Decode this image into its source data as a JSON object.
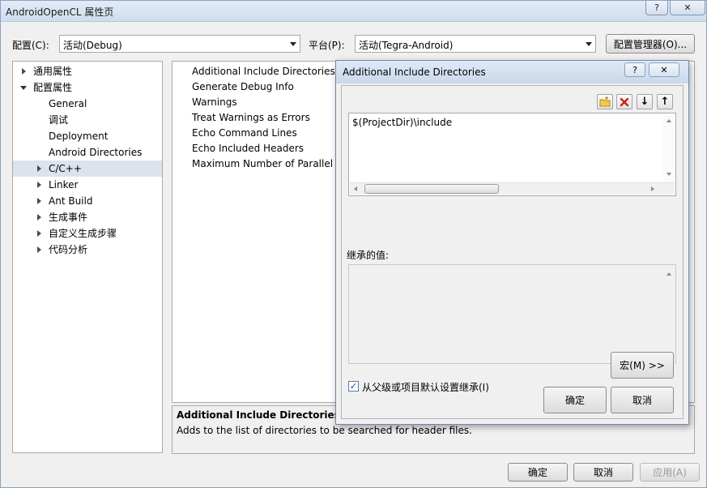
{
  "window": {
    "title": "AndroidOpenCL 属性页",
    "help_glyph": "?",
    "close_glyph": "✕"
  },
  "config": {
    "label": "配置(C):",
    "value": "活动(Debug)",
    "platform_label": "平台(P):",
    "platform_value": "活动(Tegra-Android)",
    "manager_button": "配置管理器(O)..."
  },
  "tree": {
    "items": [
      {
        "label": "通用属性",
        "expander": "collapsed",
        "indent": 0
      },
      {
        "label": "配置属性",
        "expander": "expanded",
        "indent": 0
      },
      {
        "label": "General",
        "expander": "none",
        "indent": 1
      },
      {
        "label": "调试",
        "expander": "none",
        "indent": 1
      },
      {
        "label": "Deployment",
        "expander": "none",
        "indent": 1
      },
      {
        "label": "Android Directories",
        "expander": "none",
        "indent": 1
      },
      {
        "label": "C/C++",
        "expander": "collapsed",
        "indent": 1,
        "selected": true
      },
      {
        "label": "Linker",
        "expander": "collapsed",
        "indent": 1
      },
      {
        "label": "Ant Build",
        "expander": "collapsed",
        "indent": 1
      },
      {
        "label": "生成事件",
        "expander": "collapsed",
        "indent": 1
      },
      {
        "label": "自定义生成步骤",
        "expander": "collapsed",
        "indent": 1
      },
      {
        "label": "代码分析",
        "expander": "collapsed",
        "indent": 1
      }
    ]
  },
  "grid": {
    "rows": [
      "Additional Include Directories",
      "Generate Debug Info",
      "Warnings",
      "Treat Warnings as Errors",
      "Echo Command Lines",
      "Echo Included Headers",
      "Maximum Number of Parallel ("
    ]
  },
  "description": {
    "title": "Additional Include Directories",
    "text": "Adds to the list of directories to be searched for header files."
  },
  "footer": {
    "ok": "确定",
    "cancel": "取消",
    "apply": "应用(A)"
  },
  "dialog": {
    "title": "Additional Include Directories",
    "help_glyph": "?",
    "close_glyph": "✕",
    "toolbar": {
      "new_line_icon": "folder-new-icon",
      "delete_icon": "delete-icon",
      "down_glyph": "↓",
      "up_glyph": "↑"
    },
    "entries": [
      "$(ProjectDir)\\include"
    ],
    "inherited_label": "继承的值:",
    "inherit_checkbox_label": "从父级或项目默认设置继承(I)",
    "inherit_checked": true,
    "check_glyph": "✓",
    "macros_button": "宏(M) >>",
    "ok": "确定",
    "cancel": "取消"
  }
}
